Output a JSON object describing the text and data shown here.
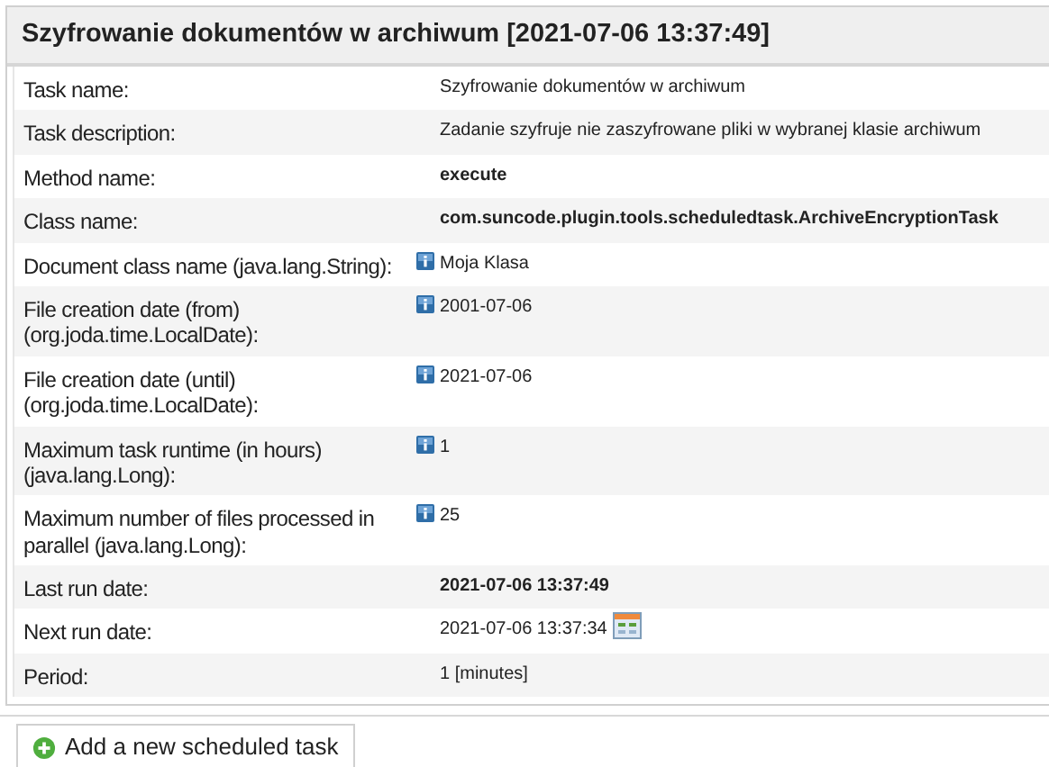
{
  "panel": {
    "title": "Szyfrowanie dokumentów w archiwum [2021-07-06 13:37:49]"
  },
  "fields": [
    {
      "label": "Task name:",
      "value": "Szyfrowanie dokumentów w archiwum",
      "kind": "plain",
      "bold": false
    },
    {
      "label": "Task description:",
      "value": "Zadanie szyfruje nie zaszyfrowane pliki w wybranej klasie archiwum",
      "kind": "plain",
      "bold": false
    },
    {
      "label": "Method name:",
      "value": "execute",
      "kind": "plain",
      "bold": true
    },
    {
      "label": "Class name:",
      "value": "com.suncode.plugin.tools.scheduledtask.ArchiveEncryptionTask",
      "kind": "plain",
      "bold": true
    },
    {
      "label": "Document class name (java.lang.String):",
      "value": "Moja Klasa",
      "kind": "parameter",
      "bold": false
    },
    {
      "label": "File creation date (from) (org.joda.time.LocalDate):",
      "value": "2001-07-06",
      "kind": "parameter",
      "bold": false
    },
    {
      "label": "File creation date (until) (org.joda.time.LocalDate):",
      "value": "2021-07-06",
      "kind": "parameter",
      "bold": false
    },
    {
      "label": "Maximum task runtime (in hours) (java.lang.Long):",
      "value": "1",
      "kind": "parameter",
      "bold": false
    },
    {
      "label": "Maximum number of files processed in parallel (java.lang.Long):",
      "value": "25",
      "kind": "parameter",
      "bold": false
    },
    {
      "label": "Last run date:",
      "value": "2021-07-06 13:37:49",
      "kind": "plain",
      "bold": true
    },
    {
      "label": "Next run date:",
      "value": "2021-07-06 13:37:34",
      "kind": "date",
      "bold": false
    },
    {
      "label": "Period:",
      "value": "1 [minutes]",
      "kind": "plain",
      "bold": false
    }
  ],
  "add_button": {
    "label": "Add a new scheduled task"
  }
}
